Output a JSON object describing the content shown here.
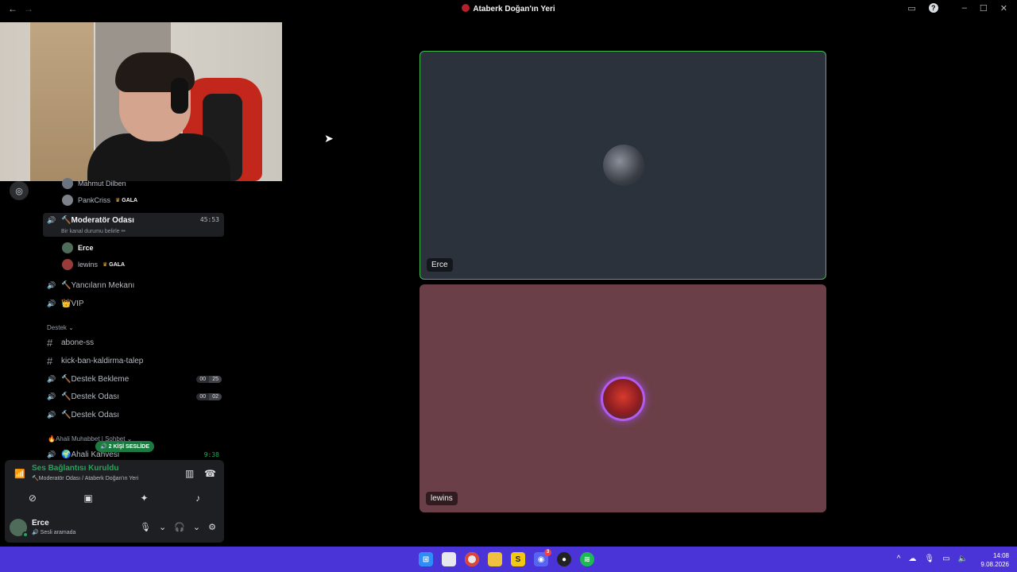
{
  "window": {
    "title": "Ataberk Doğan'ın Yeri",
    "back_glyph": "←",
    "forward_glyph": "→"
  },
  "channels": {
    "top_users": [
      {
        "name": "Mahmut Dilben",
        "badge": ""
      },
      {
        "name": "PankCriss",
        "badge": "GALA"
      }
    ],
    "moderator_room": {
      "name": "🔨Moderatör Odası",
      "timer": "45:53",
      "status_hint": "Bir kanal durumu belirle ✏",
      "users": [
        {
          "name": "Erce",
          "badge": ""
        },
        {
          "name": "lewins",
          "badge": "GALA"
        }
      ]
    },
    "voice_channels_a": [
      {
        "name": "🔨Yancıların Mekanı"
      },
      {
        "name": "👑VIP"
      }
    ],
    "category_destek": "Destek ⌄",
    "text_channels": [
      {
        "name": "abone-ss"
      },
      {
        "name": "kick-ban-kaldirma-talep"
      }
    ],
    "support_channels": [
      {
        "name": "🔨Destek Bekleme",
        "count_a": "00",
        "count_b": "25"
      },
      {
        "name": "🔨Destek Odası",
        "count_a": "00",
        "count_b": "02"
      },
      {
        "name": "🔨Destek Odası"
      }
    ],
    "category_ahali": "🔥Ahali Muhabbet | Sohbet ⌄",
    "ahali_channel": {
      "name": "🌍Ahali Kahvesi",
      "timer": "9:38"
    },
    "voice_pill": "🔊 2 KİŞİ SESLİDE"
  },
  "voice_panel": {
    "title": "Ses Bağlantısı Kuruldu",
    "subtitle": "🔨Moderatör Odası / Ataberk Doğan'ın Yeri"
  },
  "user_panel": {
    "name": "Erce",
    "status": "🔊 Sesli aramada"
  },
  "tiles": [
    {
      "name": "Erce"
    },
    {
      "name": "lewins"
    }
  ],
  "taskbar": {
    "icons": [
      "windows-start",
      "file-explorer-window",
      "chrome",
      "folder",
      "sublime",
      "discord",
      "obs",
      "spotify"
    ],
    "discord_notifications": "3",
    "time": "14:08",
    "date": "9.08.2026"
  },
  "colors": {
    "connected_green": "#23a55a",
    "speaking_border": "#3fb950",
    "tile_bg_1": "#2b323c",
    "tile_bg_2": "#6b3f47",
    "taskbar": "#4a34d8"
  }
}
